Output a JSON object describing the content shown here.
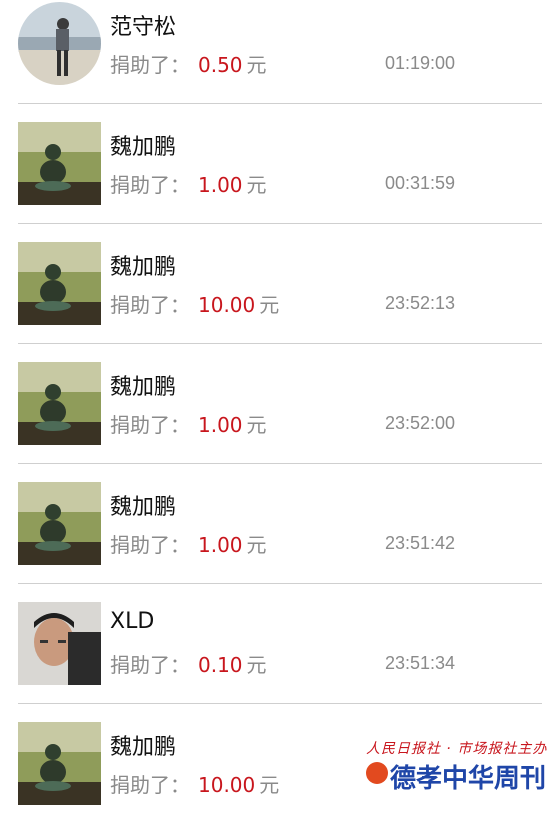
{
  "label_prefix": "捐助了：",
  "unit": "元",
  "colors": {
    "amount": "#c8161d",
    "muted": "#8a8a8a",
    "divider": "#cfcfcf",
    "brand": "#1f46a8"
  },
  "donations": [
    {
      "name": "范守松",
      "amount": "0.50",
      "time": "01:19:00",
      "avatar": "person-by-sea-photo"
    },
    {
      "name": "魏加鹏",
      "amount": "1.00",
      "time": "00:31:59",
      "avatar": "buddha-statue-photo"
    },
    {
      "name": "魏加鹏",
      "amount": "10.00",
      "time": "23:52:13",
      "avatar": "buddha-statue-photo"
    },
    {
      "name": "魏加鹏",
      "amount": "1.00",
      "time": "23:52:00",
      "avatar": "buddha-statue-photo"
    },
    {
      "name": "魏加鹏",
      "amount": "1.00",
      "time": "23:51:42",
      "avatar": "buddha-statue-photo"
    },
    {
      "name": "XLD",
      "amount": "0.10",
      "time": "23:51:34",
      "avatar": "man-portrait-photo"
    },
    {
      "name": "魏加鹏",
      "amount": "10.00",
      "time": "",
      "avatar": "buddha-statue-photo"
    }
  ],
  "watermark": {
    "top_line": "人民日报社 · 市场报社主办",
    "brand": "德孝中华周刊"
  }
}
